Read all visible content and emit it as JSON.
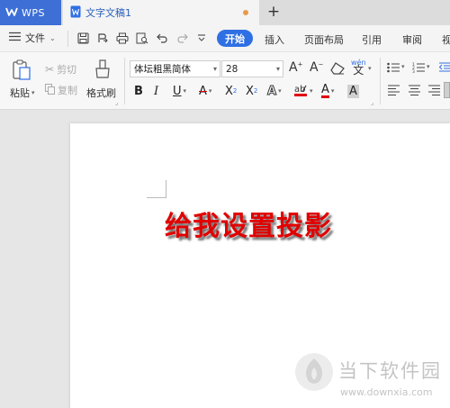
{
  "tabs": {
    "app_label": "WPS",
    "doc_label": "文字文稿1",
    "add_symbol": "+"
  },
  "menu": {
    "file_label": "文件",
    "items": [
      "开始",
      "插入",
      "页面布局",
      "引用",
      "审阅",
      "视"
    ]
  },
  "ribbon": {
    "paste_label": "粘贴",
    "cut_label": "剪切",
    "copy_label": "复制",
    "format_painter_label": "格式刷",
    "font_name": "体坛粗黑简体",
    "font_size": "28",
    "pinyin_label": "wén",
    "pinyin_char": "文",
    "bold": "B",
    "italic": "I",
    "underline": "U",
    "strike": "A",
    "superscript_base": "X",
    "superscript_exp": "2",
    "subscript_base": "X",
    "subscript_exp": "2",
    "text_effect": "A",
    "font_color": "A",
    "char_shading": "A",
    "grow_font": "A",
    "shrink_font": "A"
  },
  "document": {
    "heading": "给我设置投影"
  },
  "watermark": {
    "name": "当下软件园",
    "url": "www.downxia.com"
  },
  "colors": {
    "accent": "#2f6fe4",
    "wps_tab": "#3d6fd6",
    "heading": "#e00000",
    "modified_dot": "#e89a4a"
  }
}
